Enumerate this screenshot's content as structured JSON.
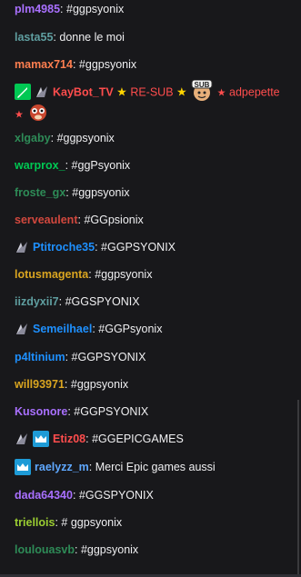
{
  "messages": [
    {
      "user": "plm4985",
      "color": "#a970ff",
      "text": " #ggpsyonix"
    },
    {
      "user": "lasta55",
      "color": "#5f9ea0",
      "text": " donne le moi"
    },
    {
      "user": "mamax714",
      "color": "#ff7f50",
      "text": " #ggpsyonix"
    },
    {
      "user": "KayBot_TV",
      "color": "#ff4d4d",
      "resub": "RE-SUB",
      "mention": "adpepette",
      "badges": [
        "moderator-icon",
        "prime-glitch-icon"
      ],
      "emote": "sub-emote-icon",
      "emote2": "blob-emote-icon"
    },
    {
      "user": "xlgaby",
      "color": "#2e8b57",
      "text": " #ggpsyonix"
    },
    {
      "user": "warprox_",
      "color": "#00c853",
      "text": " #ggPsyonix"
    },
    {
      "user": "froste_gx",
      "color": "#2e8b57",
      "text": " #ggpsyonix"
    },
    {
      "user": "serveaulent",
      "color": "#d2483e",
      "text": " #GGpsionix"
    },
    {
      "user": "Ptitroche35",
      "color": "#1e90ff",
      "text": " #GGPSYONIX",
      "badges": [
        "prime-glitch-icon"
      ]
    },
    {
      "user": "lotusmagenta",
      "color": "#daa520",
      "text": " #ggpsyonix"
    },
    {
      "user": "iizdyxii7",
      "color": "#5f9ea0",
      "text": " #GGSPYONIX"
    },
    {
      "user": "Semeilhael",
      "color": "#1e90ff",
      "text": " #GGPsyonix",
      "badges": [
        "prime-glitch-icon"
      ]
    },
    {
      "user": "p4ltinium",
      "color": "#1e90ff",
      "text": " #GGPSYONIX"
    },
    {
      "user": "will93971",
      "color": "#daa520",
      "text": " #ggpsyonix"
    },
    {
      "user": "Kusonore",
      "color": "#a970ff",
      "text": " #GGPSYONIX"
    },
    {
      "user": "Etiz08",
      "color": "#ff4d4d",
      "text": " #GGEPICGAMES",
      "badges": [
        "prime-glitch-icon",
        "crown-icon"
      ]
    },
    {
      "user": "raelyzz_m",
      "color": "#5fa8ff",
      "text": " Merci Epic games aussi",
      "badges": [
        "crown-icon"
      ]
    },
    {
      "user": "dada64340",
      "color": "#a970ff",
      "text": " #GGSPYONIX"
    },
    {
      "user": "triellois",
      "color": "#9acd32",
      "text": " # ggpsyonix"
    },
    {
      "user": "loulouasvb",
      "color": "#2e8b57",
      "text": " #ggpsyonix"
    }
  ],
  "colon": ":"
}
